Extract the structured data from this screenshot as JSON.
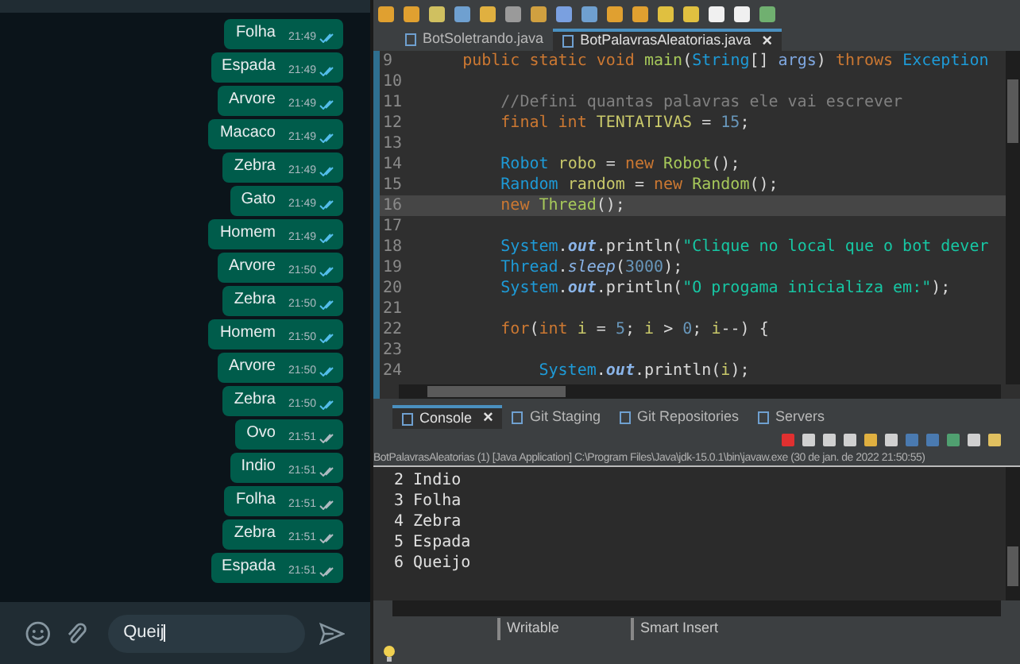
{
  "chat": {
    "messages": [
      {
        "text": "Folha",
        "time": "21:49",
        "read": true
      },
      {
        "text": "Espada",
        "time": "21:49",
        "read": true
      },
      {
        "text": "Arvore",
        "time": "21:49",
        "read": true
      },
      {
        "text": "Macaco",
        "time": "21:49",
        "read": true
      },
      {
        "text": "Zebra",
        "time": "21:49",
        "read": true
      },
      {
        "text": "Gato",
        "time": "21:49",
        "read": true
      },
      {
        "text": "Homem",
        "time": "21:49",
        "read": true
      },
      {
        "text": "Arvore",
        "time": "21:50",
        "read": true
      },
      {
        "text": "Zebra",
        "time": "21:50",
        "read": true
      },
      {
        "text": "Homem",
        "time": "21:50",
        "read": true
      },
      {
        "text": "Arvore",
        "time": "21:50",
        "read": true
      },
      {
        "text": "Zebra",
        "time": "21:50",
        "read": true
      },
      {
        "text": "Ovo",
        "time": "21:51",
        "read": false
      },
      {
        "text": "Indio",
        "time": "21:51",
        "read": false
      },
      {
        "text": "Folha",
        "time": "21:51",
        "read": false
      },
      {
        "text": "Zebra",
        "time": "21:51",
        "read": false
      },
      {
        "text": "Espada",
        "time": "21:51",
        "read": false
      }
    ],
    "input": {
      "value": "Queij"
    }
  },
  "editor": {
    "tabs": [
      {
        "label": "BotSoletrando.java",
        "selected": false
      },
      {
        "label": "BotPalavrasAleatorias.java",
        "selected": true,
        "close": "×"
      }
    ],
    "lines": [
      {
        "number": "9",
        "current": false,
        "tokens": [
          {
            "kind": "keyword",
            "text": "    public static void "
          },
          {
            "kind": "method",
            "text": "main"
          },
          {
            "kind": "plain",
            "text": "("
          },
          {
            "kind": "type",
            "text": "String"
          },
          {
            "kind": "plain",
            "text": "[] "
          },
          {
            "kind": "param",
            "text": "args"
          },
          {
            "kind": "plain",
            "text": ") "
          },
          {
            "kind": "keyword",
            "text": "throws "
          },
          {
            "kind": "type",
            "text": "Exception"
          }
        ]
      },
      {
        "number": "10",
        "current": false
      },
      {
        "number": "11",
        "current": false,
        "tokens": [
          {
            "kind": "comment",
            "text": "        //Defini quantas palavras ele vai escrever"
          }
        ]
      },
      {
        "number": "12",
        "current": false,
        "tokens": [
          {
            "kind": "keyword",
            "text": "        final int "
          },
          {
            "kind": "variable",
            "text": "TENTATIVAS"
          },
          {
            "kind": "plain",
            "text": " = "
          },
          {
            "kind": "number",
            "text": "15"
          },
          {
            "kind": "plain",
            "text": ";"
          }
        ]
      },
      {
        "number": "13",
        "current": false
      },
      {
        "number": "14",
        "current": false,
        "tokens": [
          {
            "kind": "type",
            "text": "        Robot "
          },
          {
            "kind": "variable",
            "text": "robo"
          },
          {
            "kind": "plain",
            "text": " = "
          },
          {
            "kind": "keyword",
            "text": "new "
          },
          {
            "kind": "method",
            "text": "Robot"
          },
          {
            "kind": "plain",
            "text": "();"
          }
        ]
      },
      {
        "number": "15",
        "current": false,
        "tokens": [
          {
            "kind": "type",
            "text": "        Random "
          },
          {
            "kind": "variable",
            "text": "random"
          },
          {
            "kind": "plain",
            "text": " = "
          },
          {
            "kind": "keyword",
            "text": "new "
          },
          {
            "kind": "method",
            "text": "Random"
          },
          {
            "kind": "plain",
            "text": "();"
          }
        ]
      },
      {
        "number": "16",
        "current": true,
        "tokens": [
          {
            "kind": "keyword",
            "text": "        new "
          },
          {
            "kind": "method",
            "text": "Thread"
          },
          {
            "kind": "plain",
            "text": "();"
          }
        ]
      },
      {
        "number": "17",
        "current": false
      },
      {
        "number": "18",
        "current": false,
        "tokens": [
          {
            "kind": "type",
            "text": "        System"
          },
          {
            "kind": "plain",
            "text": "."
          },
          {
            "kind": "field",
            "text": "out"
          },
          {
            "kind": "plain",
            "text": ".println("
          },
          {
            "kind": "string",
            "text": "\"Clique no local que o bot dever"
          }
        ]
      },
      {
        "number": "19",
        "current": false,
        "tokens": [
          {
            "kind": "type",
            "text": "        Thread"
          },
          {
            "kind": "plain",
            "text": "."
          },
          {
            "kind": "static",
            "text": "sleep"
          },
          {
            "kind": "plain",
            "text": "("
          },
          {
            "kind": "number",
            "text": "3000"
          },
          {
            "kind": "plain",
            "text": ");"
          }
        ]
      },
      {
        "number": "20",
        "current": false,
        "tokens": [
          {
            "kind": "type",
            "text": "        System"
          },
          {
            "kind": "plain",
            "text": "."
          },
          {
            "kind": "field",
            "text": "out"
          },
          {
            "kind": "plain",
            "text": ".println("
          },
          {
            "kind": "string",
            "text": "\"O progama inicializa em:\""
          },
          {
            "kind": "plain",
            "text": ");"
          }
        ]
      },
      {
        "number": "21",
        "current": false
      },
      {
        "number": "22",
        "current": false,
        "tokens": [
          {
            "kind": "keyword",
            "text": "        for"
          },
          {
            "kind": "plain",
            "text": "("
          },
          {
            "kind": "keyword",
            "text": "int "
          },
          {
            "kind": "variable",
            "text": "i"
          },
          {
            "kind": "plain",
            "text": " = "
          },
          {
            "kind": "number",
            "text": "5"
          },
          {
            "kind": "plain",
            "text": "; "
          },
          {
            "kind": "variable",
            "text": "i"
          },
          {
            "kind": "plain",
            "text": " > "
          },
          {
            "kind": "number",
            "text": "0"
          },
          {
            "kind": "plain",
            "text": "; "
          },
          {
            "kind": "variable",
            "text": "i"
          },
          {
            "kind": "plain",
            "text": "--) {"
          }
        ]
      },
      {
        "number": "23",
        "current": false
      },
      {
        "number": "24",
        "current": false,
        "tokens": [
          {
            "kind": "type",
            "text": "            System"
          },
          {
            "kind": "plain",
            "text": "."
          },
          {
            "kind": "field",
            "text": "out"
          },
          {
            "kind": "plain",
            "text": ".println("
          },
          {
            "kind": "variable",
            "text": "i"
          },
          {
            "kind": "plain",
            "text": ");"
          }
        ]
      }
    ]
  },
  "console": {
    "tabs": [
      {
        "label": "Console",
        "selected": true,
        "close": "×"
      },
      {
        "label": "Git Staging",
        "selected": false
      },
      {
        "label": "Git Repositories",
        "selected": false
      },
      {
        "label": "Servers",
        "selected": false
      }
    ],
    "launch": "BotPalavrasAleatorias (1) [Java Application] C:\\Program Files\\Java\\jdk-15.0.1\\bin\\javaw.exe  (30 de jan. de 2022 21:50:55)",
    "output": [
      "2 Indio",
      "3 Folha",
      "4 Zebra",
      "5 Espada",
      "6 Queijo"
    ]
  },
  "status_bar": [
    "Writable",
    "Smart Insert"
  ]
}
